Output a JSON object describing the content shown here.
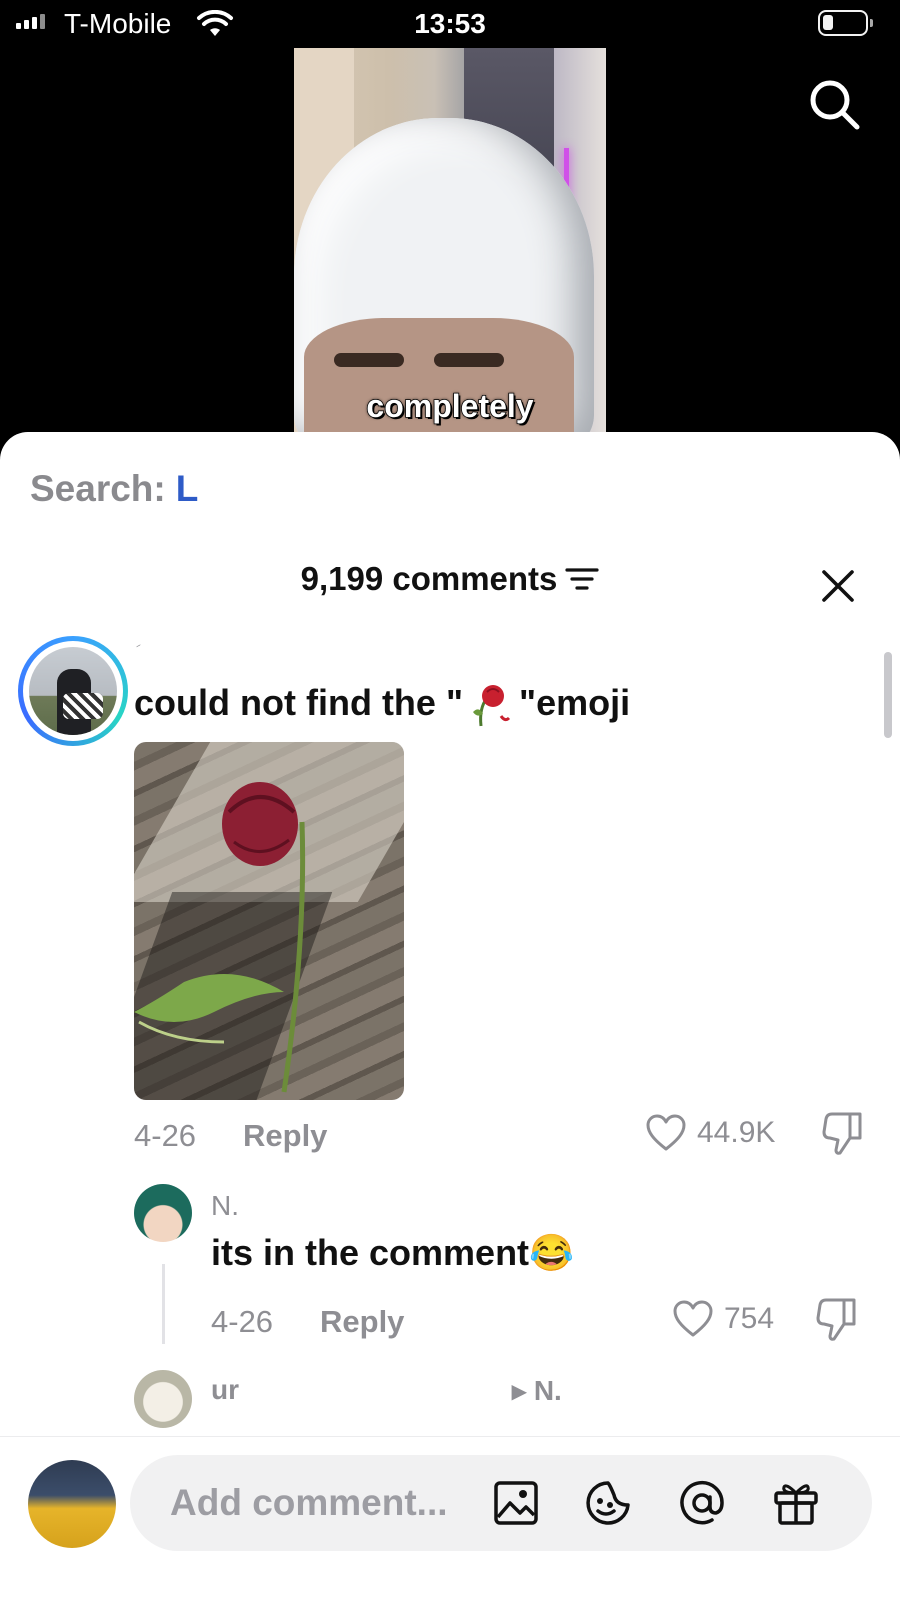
{
  "status": {
    "carrier": "T-Mobile",
    "time": "13:53"
  },
  "video": {
    "caption": "completely"
  },
  "search": {
    "label": "Search:",
    "term": "L"
  },
  "comments_header": {
    "title": "9,199 comments"
  },
  "comments": [
    {
      "username": "ؘ",
      "text_before": "could not find the \"",
      "text_after": "\"emoji",
      "date": "4-26",
      "reply_label": "Reply",
      "likes": "44.9K"
    },
    {
      "username": "N.",
      "text": "its in the comment😂",
      "date": "4-26",
      "reply_label": "Reply",
      "likes": "754"
    },
    {
      "username": "ur",
      "reply_to": "▸ N."
    }
  ],
  "composer": {
    "placeholder": "Add comment..."
  },
  "colors": {
    "accent": "#2e5bc7",
    "muted": "#8e8e93",
    "text": "#111111"
  }
}
